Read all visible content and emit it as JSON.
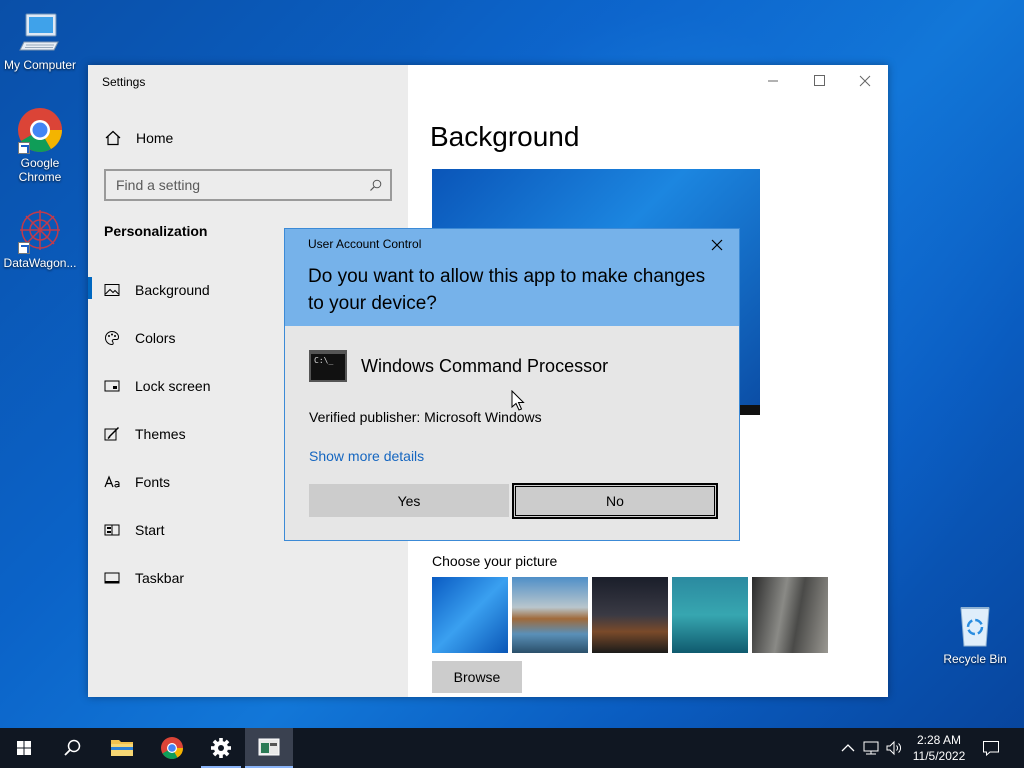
{
  "desktop": {
    "icons": [
      {
        "label": "My Computer"
      },
      {
        "label": "Google Chrome"
      },
      {
        "label": "DataWagon..."
      },
      {
        "label": "Recycle Bin"
      }
    ]
  },
  "settings": {
    "window_title": "Settings",
    "home_label": "Home",
    "search_placeholder": "Find a setting",
    "section_title": "Personalization",
    "nav": [
      {
        "label": "Background",
        "icon": "picture-icon",
        "active": true
      },
      {
        "label": "Colors",
        "icon": "palette-icon"
      },
      {
        "label": "Lock screen",
        "icon": "lock-screen-icon"
      },
      {
        "label": "Themes",
        "icon": "brush-icon"
      },
      {
        "label": "Fonts",
        "icon": "font-icon"
      },
      {
        "label": "Start",
        "icon": "start-icon"
      },
      {
        "label": "Taskbar",
        "icon": "taskbar-icon"
      }
    ],
    "content_title": "Background",
    "choose_label": "Choose your picture",
    "browse_label": "Browse",
    "accent_color": "#0067c0"
  },
  "uac": {
    "title": "User Account Control",
    "question": "Do you want to allow this app to make changes to your device?",
    "app_name": "Windows Command Processor",
    "app_icon_text": "C:\\_",
    "publisher": "Verified publisher: Microsoft Windows",
    "more_details": "Show more details",
    "yes_label": "Yes",
    "no_label": "No",
    "header_color": "#76b2ea"
  },
  "taskbar": {
    "time": "2:28 AM",
    "date": "11/5/2022",
    "bg_color": "#101722"
  }
}
